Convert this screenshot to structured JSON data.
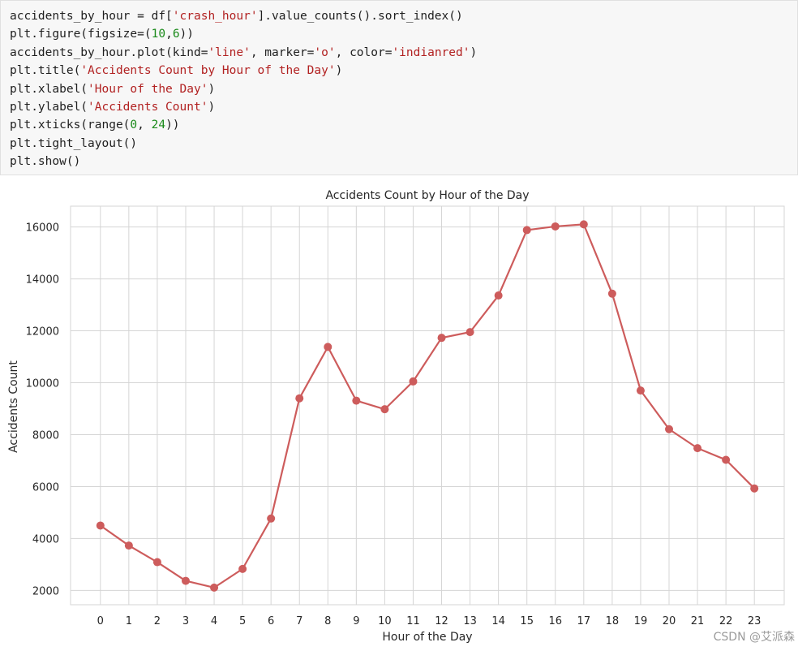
{
  "code": {
    "lines": [
      [
        {
          "t": "accidents_by_hour = df["
        },
        {
          "t": "'crash_hour'",
          "c": "str"
        },
        {
          "t": "].value_counts().sort_index()"
        }
      ],
      [
        {
          "t": "plt.figure(figsize=("
        },
        {
          "t": "10",
          "c": "num"
        },
        {
          "t": ","
        },
        {
          "t": "6",
          "c": "num"
        },
        {
          "t": "))"
        }
      ],
      [
        {
          "t": "accidents_by_hour.plot(kind="
        },
        {
          "t": "'line'",
          "c": "str"
        },
        {
          "t": ", marker="
        },
        {
          "t": "'o'",
          "c": "str"
        },
        {
          "t": ", color="
        },
        {
          "t": "'indianred'",
          "c": "str"
        },
        {
          "t": ")"
        }
      ],
      [
        {
          "t": "plt.title("
        },
        {
          "t": "'Accidents Count by Hour of the Day'",
          "c": "str"
        },
        {
          "t": ")"
        }
      ],
      [
        {
          "t": "plt.xlabel("
        },
        {
          "t": "'Hour of the Day'",
          "c": "str"
        },
        {
          "t": ")"
        }
      ],
      [
        {
          "t": "plt.ylabel("
        },
        {
          "t": "'Accidents Count'",
          "c": "str"
        },
        {
          "t": ")"
        }
      ],
      [
        {
          "t": "plt.xticks(range("
        },
        {
          "t": "0",
          "c": "num"
        },
        {
          "t": ", "
        },
        {
          "t": "24",
          "c": "num"
        },
        {
          "t": "))"
        }
      ],
      [
        {
          "t": "plt.tight_layout()"
        }
      ],
      [
        {
          "t": "plt.show()"
        }
      ]
    ]
  },
  "chart_data": {
    "type": "line",
    "title": "Accidents Count by Hour of the Day",
    "xlabel": "Hour of the Day",
    "ylabel": "Accidents Count",
    "x": [
      0,
      1,
      2,
      3,
      4,
      5,
      6,
      7,
      8,
      9,
      10,
      11,
      12,
      13,
      14,
      15,
      16,
      17,
      18,
      19,
      20,
      21,
      22,
      23
    ],
    "series": [
      {
        "values": [
          4500,
          3730,
          3090,
          2370,
          2110,
          2830,
          4770,
          9400,
          11380,
          9310,
          8980,
          10050,
          11730,
          11950,
          13360,
          15880,
          16020,
          16100,
          13430,
          9700,
          8210,
          7480,
          7030,
          5930
        ]
      }
    ],
    "yticks": [
      2000,
      4000,
      6000,
      8000,
      10000,
      12000,
      14000,
      16000
    ],
    "ylim": [
      1450,
      16800
    ],
    "xlim": [
      -1.05,
      24.05
    ],
    "grid": true,
    "color": "#cd5c5c",
    "marker": "circle"
  },
  "watermark": "CSDN @艾派森"
}
